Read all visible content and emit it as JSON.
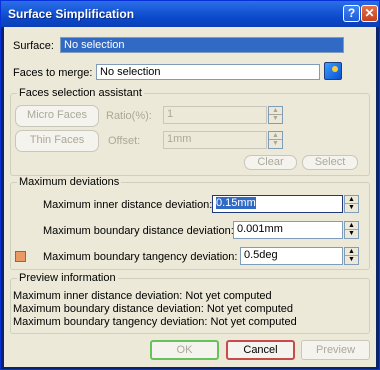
{
  "window": {
    "title": "Surface Simplification",
    "help_glyph": "?",
    "close_glyph": "✕"
  },
  "surface": {
    "label": "Surface:",
    "value": "No selection"
  },
  "faces_to_merge": {
    "label": "Faces to merge:",
    "value": "No selection"
  },
  "assistant": {
    "title": "Faces selection assistant",
    "micro_faces": "Micro Faces",
    "thin_faces": "Thin Faces",
    "ratio_label": "Ratio(%):",
    "ratio_value": "1",
    "offset_label": "Offset:",
    "offset_value": "1mm",
    "clear": "Clear",
    "select": "Select"
  },
  "deviations": {
    "title": "Maximum deviations",
    "inner_label": "Maximum inner distance deviation:",
    "inner_value": "0.15mm",
    "boundary_label": "Maximum boundary distance deviation:",
    "boundary_value": "0.001mm",
    "tangency_label": "Maximum boundary tangency deviation:",
    "tangency_value": "0.5deg",
    "tangency_swatch_color": "#e99a64"
  },
  "preview": {
    "title": "Preview information",
    "line1": "Maximum inner distance deviation: Not yet computed",
    "line2": "Maximum boundary distance deviation: Not yet computed",
    "line3": "Maximum boundary tangency deviation: Not yet computed"
  },
  "footer": {
    "ok": "OK",
    "cancel": "Cancel",
    "preview": "Preview"
  },
  "spin": {
    "up": "▲",
    "down": "▼"
  }
}
